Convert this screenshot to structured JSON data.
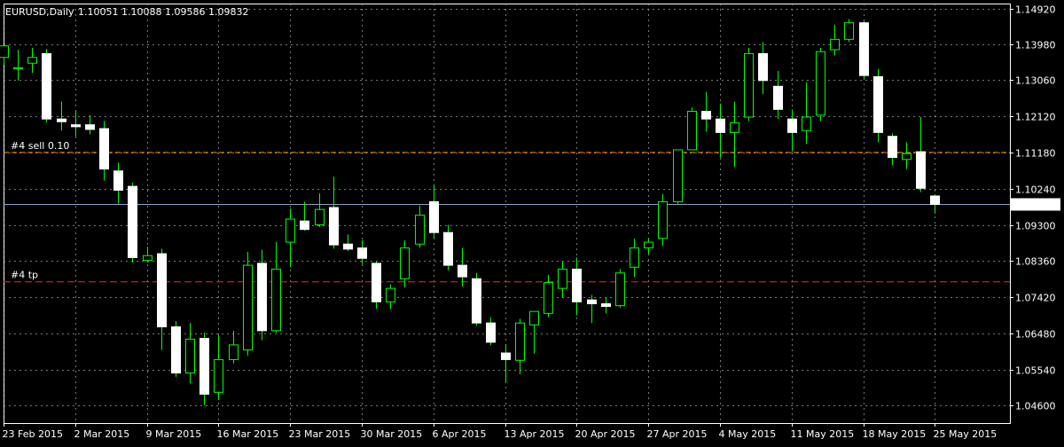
{
  "header": {
    "symbol_timeframe": "EURUSD,Daily",
    "ohlc": "1.10051 1.10088 1.09586 1.09832"
  },
  "colors": {
    "background": "#000000",
    "grid": "#c8c8c8",
    "bull_candle": "#000000",
    "bear_candle": "#ffffff",
    "candle_outline": "#00ff00",
    "wick": "#00ff00",
    "bid_line": "#8aa0c8",
    "order_line": "#ff8c00",
    "tp_line": "#ff2020",
    "axis_text": "#ffffff"
  },
  "chart_data": {
    "type": "candlestick",
    "symbol": "EURUSD",
    "timeframe": "Daily",
    "ylim": [
      1.0415,
      1.1505
    ],
    "grid": true,
    "y_ticks": [
      1.1492,
      1.1398,
      1.1306,
      1.1212,
      1.1118,
      1.1024,
      1.093,
      1.0836,
      1.0742,
      1.0648,
      1.0554,
      1.046
    ],
    "y_tick_labels": [
      "1.14920",
      "1.13980",
      "1.13060",
      "1.12120",
      "1.11180",
      "1.10240",
      "1.09300",
      "1.08360",
      "1.07420",
      "1.06480",
      "1.05540",
      "1.04600"
    ],
    "x_labels": [
      "23 Feb 2015",
      "2 Mar 2015",
      "9 Mar 2015",
      "16 Mar 2015",
      "23 Mar 2015",
      "30 Mar 2015",
      "6 Apr 2015",
      "13 Apr 2015",
      "20 Apr 2015",
      "27 Apr 2015",
      "4 May 2015",
      "11 May 2015",
      "18 May 2015",
      "25 May 2015"
    ],
    "current_price": 1.09832,
    "current_price_label": "1.09832",
    "candles": [
      {
        "o": 1.1365,
        "h": 1.1395,
        "l": 1.1345,
        "c": 1.1395
      },
      {
        "o": 1.1335,
        "h": 1.1385,
        "l": 1.1305,
        "c": 1.1338
      },
      {
        "o": 1.135,
        "h": 1.139,
        "l": 1.1325,
        "c": 1.1365
      },
      {
        "o": 1.1375,
        "h": 1.1387,
        "l": 1.1196,
        "c": 1.1205
      },
      {
        "o": 1.1205,
        "h": 1.125,
        "l": 1.1175,
        "c": 1.1198
      },
      {
        "o": 1.119,
        "h": 1.1225,
        "l": 1.116,
        "c": 1.1185
      },
      {
        "o": 1.119,
        "h": 1.1215,
        "l": 1.1165,
        "c": 1.1178
      },
      {
        "o": 1.118,
        "h": 1.12,
        "l": 1.1045,
        "c": 1.1075
      },
      {
        "o": 1.107,
        "h": 1.1092,
        "l": 1.0985,
        "c": 1.102
      },
      {
        "o": 1.103,
        "h": 1.104,
        "l": 1.0832,
        "c": 1.0845
      },
      {
        "o": 1.0838,
        "h": 1.0873,
        "l": 1.0832,
        "c": 1.085
      },
      {
        "o": 1.0855,
        "h": 1.0868,
        "l": 1.0605,
        "c": 1.0665
      },
      {
        "o": 1.0665,
        "h": 1.068,
        "l": 1.0535,
        "c": 1.0545
      },
      {
        "o": 1.0545,
        "h": 1.0675,
        "l": 1.0518,
        "c": 1.0633
      },
      {
        "o": 1.0635,
        "h": 1.065,
        "l": 1.0462,
        "c": 1.049
      },
      {
        "o": 1.0495,
        "h": 1.0643,
        "l": 1.0475,
        "c": 1.058
      },
      {
        "o": 1.058,
        "h": 1.0655,
        "l": 1.057,
        "c": 1.0618
      },
      {
        "o": 1.0605,
        "h": 1.086,
        "l": 1.059,
        "c": 1.0825
      },
      {
        "o": 1.083,
        "h": 1.0865,
        "l": 1.063,
        "c": 1.0655
      },
      {
        "o": 1.0655,
        "h": 1.0885,
        "l": 1.065,
        "c": 1.0815
      },
      {
        "o": 1.0885,
        "h": 1.0972,
        "l": 1.082,
        "c": 1.0945
      },
      {
        "o": 1.094,
        "h": 1.099,
        "l": 1.0915,
        "c": 1.0918
      },
      {
        "o": 1.093,
        "h": 1.1012,
        "l": 1.0925,
        "c": 1.097
      },
      {
        "o": 1.0975,
        "h": 1.1055,
        "l": 1.0868,
        "c": 1.0878
      },
      {
        "o": 1.088,
        "h": 1.0905,
        "l": 1.0862,
        "c": 1.0867
      },
      {
        "o": 1.087,
        "h": 1.089,
        "l": 1.0828,
        "c": 1.0843
      },
      {
        "o": 1.083,
        "h": 1.0835,
        "l": 1.0712,
        "c": 1.073
      },
      {
        "o": 1.073,
        "h": 1.0775,
        "l": 1.0712,
        "c": 1.0765
      },
      {
        "o": 1.079,
        "h": 1.089,
        "l": 1.0768,
        "c": 1.087
      },
      {
        "o": 1.088,
        "h": 1.098,
        "l": 1.087,
        "c": 1.0955
      },
      {
        "o": 1.099,
        "h": 1.1035,
        "l": 1.0895,
        "c": 1.091
      },
      {
        "o": 1.091,
        "h": 1.093,
        "l": 1.0812,
        "c": 1.0825
      },
      {
        "o": 1.0825,
        "h": 1.087,
        "l": 1.077,
        "c": 1.0795
      },
      {
        "o": 1.079,
        "h": 1.0805,
        "l": 1.0668,
        "c": 1.0675
      },
      {
        "o": 1.0675,
        "h": 1.069,
        "l": 1.0617,
        "c": 1.0625
      },
      {
        "o": 1.0597,
        "h": 1.062,
        "l": 1.052,
        "c": 1.058
      },
      {
        "o": 1.0578,
        "h": 1.0686,
        "l": 1.0542,
        "c": 1.0675
      },
      {
        "o": 1.067,
        "h": 1.0705,
        "l": 1.0595,
        "c": 1.0705
      },
      {
        "o": 1.07,
        "h": 1.08,
        "l": 1.069,
        "c": 1.078
      },
      {
        "o": 1.0765,
        "h": 1.0835,
        "l": 1.074,
        "c": 1.0815
      },
      {
        "o": 1.0815,
        "h": 1.0845,
        "l": 1.0695,
        "c": 1.073
      },
      {
        "o": 1.0735,
        "h": 1.0748,
        "l": 1.0675,
        "c": 1.0725
      },
      {
        "o": 1.0725,
        "h": 1.074,
        "l": 1.07,
        "c": 1.0718
      },
      {
        "o": 1.072,
        "h": 1.0815,
        "l": 1.0715,
        "c": 1.0805
      },
      {
        "o": 1.082,
        "h": 1.0895,
        "l": 1.0795,
        "c": 1.087
      },
      {
        "o": 1.087,
        "h": 1.0895,
        "l": 1.0855,
        "c": 1.0885
      },
      {
        "o": 1.0895,
        "h": 1.101,
        "l": 1.0875,
        "c": 1.099
      },
      {
        "o": 1.099,
        "h": 1.1125,
        "l": 1.0985,
        "c": 1.1125
      },
      {
        "o": 1.1125,
        "h": 1.1235,
        "l": 1.1125,
        "c": 1.1225
      },
      {
        "o": 1.1225,
        "h": 1.1275,
        "l": 1.1172,
        "c": 1.1205
      },
      {
        "o": 1.1205,
        "h": 1.1245,
        "l": 1.1105,
        "c": 1.117
      },
      {
        "o": 1.117,
        "h": 1.125,
        "l": 1.108,
        "c": 1.1195
      },
      {
        "o": 1.121,
        "h": 1.139,
        "l": 1.12,
        "c": 1.1375
      },
      {
        "o": 1.1375,
        "h": 1.1405,
        "l": 1.127,
        "c": 1.1305
      },
      {
        "o": 1.129,
        "h": 1.133,
        "l": 1.1205,
        "c": 1.123
      },
      {
        "o": 1.1205,
        "h": 1.123,
        "l": 1.112,
        "c": 1.117
      },
      {
        "o": 1.1175,
        "h": 1.13,
        "l": 1.114,
        "c": 1.121
      },
      {
        "o": 1.1215,
        "h": 1.139,
        "l": 1.12,
        "c": 1.138
      },
      {
        "o": 1.1385,
        "h": 1.145,
        "l": 1.137,
        "c": 1.1412
      },
      {
        "o": 1.1412,
        "h": 1.1465,
        "l": 1.1405,
        "c": 1.1455
      },
      {
        "o": 1.1455,
        "h": 1.146,
        "l": 1.131,
        "c": 1.1318
      },
      {
        "o": 1.1315,
        "h": 1.1335,
        "l": 1.1145,
        "c": 1.117
      },
      {
        "o": 1.116,
        "h": 1.1168,
        "l": 1.1085,
        "c": 1.1105
      },
      {
        "o": 1.11,
        "h": 1.1145,
        "l": 1.1075,
        "c": 1.1115
      },
      {
        "o": 1.112,
        "h": 1.121,
        "l": 1.1015,
        "c": 1.1025
      },
      {
        "o": 1.1005,
        "h": 1.1009,
        "l": 1.0959,
        "c": 1.0983
      }
    ],
    "trade_labels": {
      "sell": "#4 sell 0.10",
      "tp": "#4 tp"
    },
    "trade_levels": {
      "sell": 1.1118,
      "tp": 1.0782
    }
  }
}
